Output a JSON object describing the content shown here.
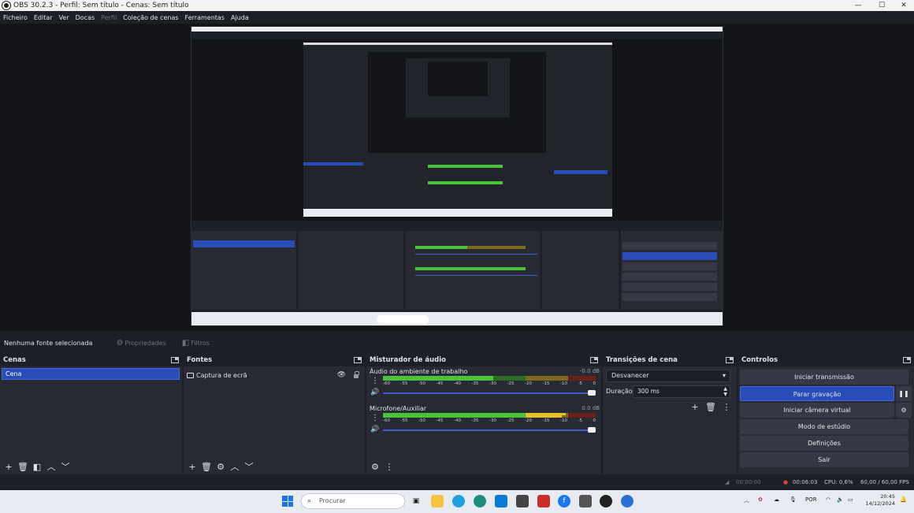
{
  "window": {
    "title": "OBS 30.2.3 - Perfil: Sem título - Cenas: Sem título",
    "min": "—",
    "max": "☐",
    "close": "✕"
  },
  "menu": [
    "Ficheiro",
    "Editar",
    "Ver",
    "Docas",
    "Perfil",
    "Coleção de cenas",
    "Ferramentas",
    "Ajuda"
  ],
  "source_toolbar": {
    "no_source": "Nenhuma fonte selecionada",
    "properties": "Propriedades",
    "filters": "Filtros"
  },
  "scenes": {
    "title": "Cenas",
    "items": [
      "Cena"
    ]
  },
  "sources": {
    "title": "Fontes",
    "items": [
      "Captura de ecrã"
    ]
  },
  "mixer": {
    "title": "Misturador de áudio",
    "channels": [
      {
        "name": "Áudio do ambiente de trabalho",
        "db": "-0.0 dB"
      },
      {
        "name": "Microfone/Auxiliar",
        "db": "0.0 dB"
      }
    ],
    "scale": [
      "-60",
      "-55",
      "-50",
      "-45",
      "-40",
      "-35",
      "-30",
      "-25",
      "-20",
      "-15",
      "-10",
      "-5",
      "0"
    ]
  },
  "transitions": {
    "title": "Transições de cena",
    "selected": "Desvanecer",
    "duration_label": "Duração",
    "duration_value": "300 ms"
  },
  "controls": {
    "title": "Controlos",
    "buttons": [
      "Iniciar transmissão",
      "Parar gravação",
      "Iniciar câmera virtual",
      "Modo de estúdio",
      "Definições",
      "Sair"
    ]
  },
  "status": {
    "stream_time": "00:00:00",
    "rec_time": "00:06:03",
    "cpu": "CPU: 0,6%",
    "fps": "60,00 / 60,00 FPS"
  },
  "taskbar": {
    "search_placeholder": "Procurar",
    "lang": "POR",
    "time": "20:45",
    "date": "14/12/2024"
  }
}
